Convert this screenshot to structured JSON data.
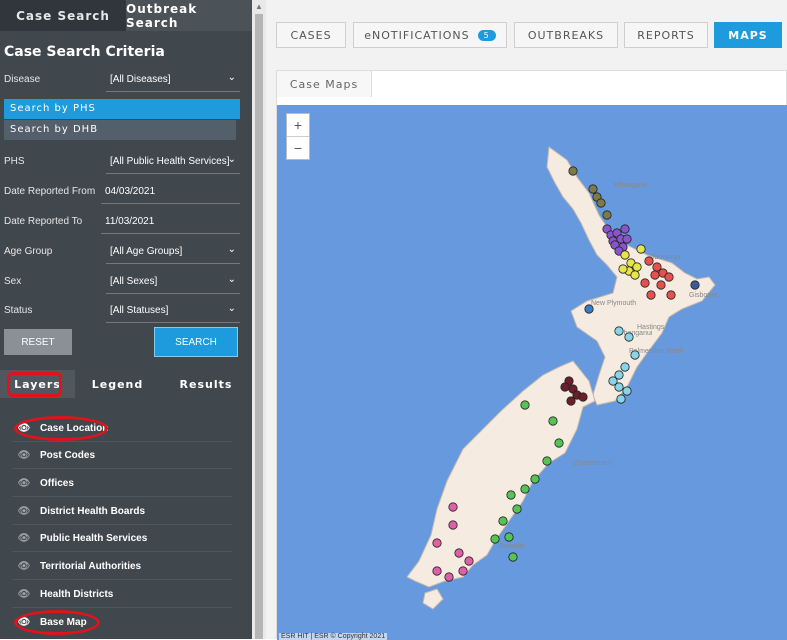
{
  "sidebar": {
    "top_tabs": [
      "Case Search",
      "Outbreak Search"
    ],
    "criteria_title": "Case Search Criteria",
    "disease": {
      "label": "Disease",
      "value": "[All Diseases]"
    },
    "search_by_phs": "Search by PHS",
    "search_by_dhb": "Search by DHB",
    "phs": {
      "label": "PHS",
      "value": "[All Public Health Services]"
    },
    "date_from": {
      "label": "Date Reported From",
      "value": "04/03/2021"
    },
    "date_to": {
      "label": "Date Reported To",
      "value": "11/03/2021"
    },
    "age_group": {
      "label": "Age Group",
      "value": "[All Age Groups]"
    },
    "sex": {
      "label": "Sex",
      "value": "[All Sexes]"
    },
    "status": {
      "label": "Status",
      "value": "[All Statuses]"
    },
    "reset_label": "RESET",
    "search_label": "SEARCH",
    "sub_tabs": [
      "Layers",
      "Legend",
      "Results"
    ],
    "layers": [
      "Case Location",
      "Post Codes",
      "Offices",
      "District Health Boards",
      "Public Health Services",
      "Territorial Authorities",
      "Health Districts",
      "Base Map"
    ]
  },
  "nav": {
    "cases": "CASES",
    "enotifications": "eNOTIFICATIONS",
    "enotifications_count": "5",
    "outbreaks": "OUTBREAKS",
    "reports": "REPORTS",
    "maps": "MAPS"
  },
  "map": {
    "tab_label": "Case Maps",
    "zoom_in": "+",
    "zoom_out": "−",
    "copyright": "ESR HIT | ESR © Copyright 2021",
    "place_labels": [
      "Whangarei",
      "Tauranga",
      "Gisborne",
      "New Plymouth",
      "Whanganui",
      "Hastings",
      "Palmerston North",
      "Christchurch",
      "Dunedin"
    ],
    "colors": {
      "sea": "#6699dd",
      "land": "#f5ebe0",
      "accent": "#1e9bdc"
    }
  }
}
